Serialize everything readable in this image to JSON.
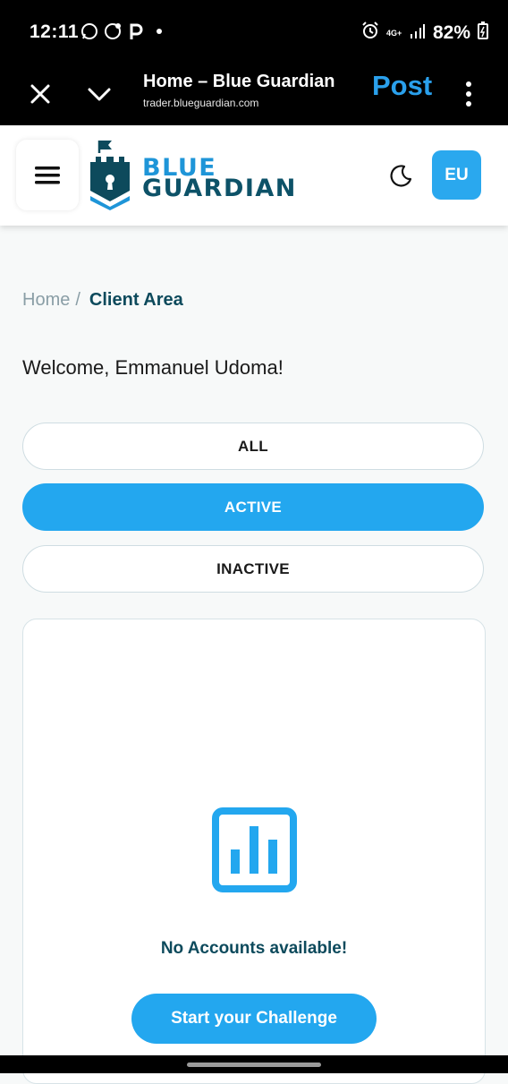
{
  "status_bar": {
    "time": "12:11",
    "left_icons": [
      "whatsapp-icon",
      "whatsapp-business-icon",
      "pinterest-p-icon",
      "dot-icon"
    ],
    "network": "4G+",
    "battery": "82%"
  },
  "tab_bar": {
    "title": "Home – Blue Guardian",
    "url": "trader.blueguardian.com",
    "post_label": "Post"
  },
  "header": {
    "logo_line1": "BLUE",
    "logo_line2": "GUARDIAN",
    "lang_label": "EU"
  },
  "breadcrumb": {
    "home": "Home",
    "separator": "/",
    "current": "Client Area"
  },
  "welcome": "Welcome, Emmanuel Udoma!",
  "filters": [
    {
      "label": "ALL",
      "active": false
    },
    {
      "label": "ACTIVE",
      "active": true
    },
    {
      "label": "INACTIVE",
      "active": false
    }
  ],
  "accounts": {
    "empty_message": "No Accounts available!",
    "cta_label": "Start your Challenge"
  },
  "colors": {
    "accent": "#23a7ef",
    "brand_dark": "#0d4a5c",
    "logo_blue": "#1e95d8",
    "post_blue": "#2aa0ec"
  }
}
